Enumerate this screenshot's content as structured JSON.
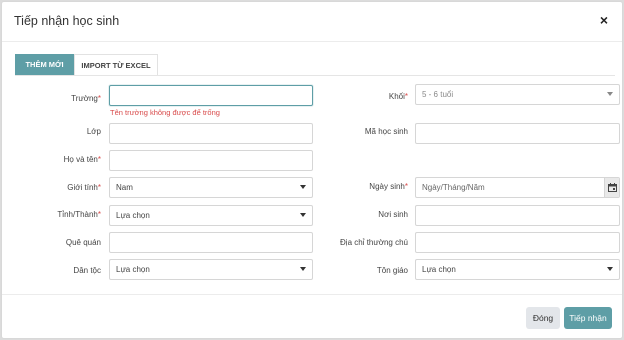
{
  "modal": {
    "title": "Tiếp nhận học sinh",
    "close_label": "×"
  },
  "tabs": [
    {
      "label": "THÊM MỚI",
      "active": true
    },
    {
      "label": "IMPORT TỪ EXCEL",
      "active": false
    }
  ],
  "form": {
    "required_mark": "*",
    "truong": {
      "label": "Trường",
      "value": "",
      "error": "Tên trường không được để trống"
    },
    "khoi": {
      "label": "Khối",
      "value": "5 - 6 tuổi"
    },
    "lop": {
      "label": "Lớp",
      "value": ""
    },
    "ma_hoc_sinh": {
      "label": "Mã học sinh",
      "value": ""
    },
    "ho_va_ten": {
      "label": "Họ và tên",
      "value": ""
    },
    "gioi_tinh": {
      "label": "Giới tính",
      "value": "Nam"
    },
    "ngay_sinh": {
      "label": "Ngày sinh",
      "placeholder": "Ngày/Tháng/Năm"
    },
    "tinh_thanh": {
      "label": "Tỉnh/Thành",
      "value": "Lựa chọn"
    },
    "noi_sinh": {
      "label": "Nơi sinh",
      "value": ""
    },
    "que_quan": {
      "label": "Quê quán",
      "value": ""
    },
    "dia_chi": {
      "label": "Địa chỉ thường chú",
      "value": ""
    },
    "dan_toc": {
      "label": "Dân tộc",
      "value": "Lựa chọn"
    },
    "ton_giao": {
      "label": "Tôn giáo",
      "value": "Lựa chọn"
    }
  },
  "footer": {
    "close_label": "Đóng",
    "submit_label": "Tiếp nhận"
  },
  "colors": {
    "accent": "#5e9ea6",
    "error": "#d84a4a"
  }
}
